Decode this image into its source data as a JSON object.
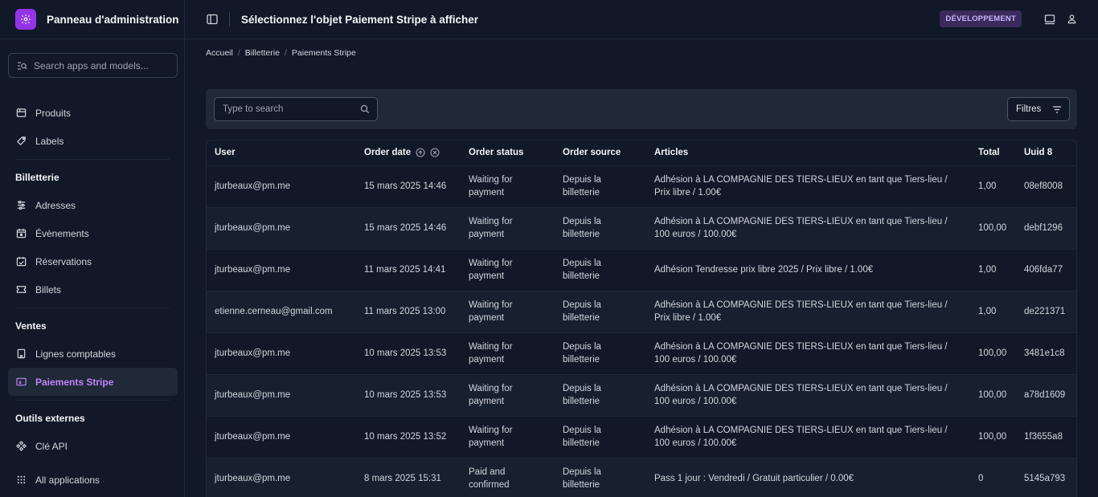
{
  "brand": {
    "title": "Panneau d'administration"
  },
  "sidebar": {
    "search_placeholder": "Search apps and models...",
    "items_top": [
      {
        "label": "Produits",
        "icon": "box-icon"
      },
      {
        "label": "Labels",
        "icon": "tag-icon"
      }
    ],
    "sections": [
      {
        "title": "Billetterie",
        "items": [
          {
            "label": "Adresses",
            "icon": "sliders-icon"
          },
          {
            "label": "Évènements",
            "icon": "calendar-icon"
          },
          {
            "label": "Réservations",
            "icon": "reservation-icon"
          },
          {
            "label": "Billets",
            "icon": "ticket-icon"
          }
        ]
      },
      {
        "title": "Ventes",
        "items": [
          {
            "label": "Lignes comptables",
            "icon": "document-icon"
          },
          {
            "label": "Paiements Stripe",
            "icon": "payment-icon",
            "active": true
          }
        ]
      },
      {
        "title": "Outils externes",
        "items": [
          {
            "label": "Clé API",
            "icon": "api-icon"
          }
        ]
      }
    ],
    "all_apps": "All applications"
  },
  "header": {
    "title": "Sélectionnez l'objet Paiement Stripe à afficher",
    "env_badge": "DÉVELOPPEMENT"
  },
  "breadcrumb": [
    "Accueil",
    "Billetterie",
    "Paiements Stripe"
  ],
  "toolbar": {
    "search_placeholder": "Type to search",
    "filters_label": "Filtres"
  },
  "table": {
    "columns": [
      "User",
      "Order date",
      "Order status",
      "Order source",
      "Articles",
      "Total",
      "Uuid 8"
    ],
    "rows": [
      {
        "user": "jturbeaux@pm.me",
        "date": "15 mars 2025 14:46",
        "status_1": "Waiting for",
        "status_2": "payment",
        "source_1": "Depuis la",
        "source_2": "billetterie",
        "art_1": "Adhésion à LA COMPAGNIE DES TIERS-LIEUX en tant que Tiers-lieu /",
        "art_2": "Prix libre / 1.00€",
        "total": "1,00",
        "uuid": "08ef8008"
      },
      {
        "user": "jturbeaux@pm.me",
        "date": "15 mars 2025 14:46",
        "status_1": "Waiting for",
        "status_2": "payment",
        "source_1": "Depuis la",
        "source_2": "billetterie",
        "art_1": "Adhésion à LA COMPAGNIE DES TIERS-LIEUX en tant que Tiers-lieu /",
        "art_2": "100 euros / 100.00€",
        "total": "100,00",
        "uuid": "debf1296"
      },
      {
        "user": "jturbeaux@pm.me",
        "date": "11 mars 2025 14:41",
        "status_1": "Waiting for",
        "status_2": "payment",
        "source_1": "Depuis la",
        "source_2": "billetterie",
        "art_1": "Adhésion Tendresse prix libre 2025 / Prix libre / 1.00€",
        "art_2": "",
        "total": "1,00",
        "uuid": "406fda77"
      },
      {
        "user": "etienne.cerneau@gmail.com",
        "date": "11 mars 2025 13:00",
        "status_1": "Waiting for",
        "status_2": "payment",
        "source_1": "Depuis la",
        "source_2": "billetterie",
        "art_1": "Adhésion à LA COMPAGNIE DES TIERS-LIEUX en tant que Tiers-lieu /",
        "art_2": "Prix libre / 1.00€",
        "total": "1,00",
        "uuid": "de221371"
      },
      {
        "user": "jturbeaux@pm.me",
        "date": "10 mars 2025 13:53",
        "status_1": "Waiting for",
        "status_2": "payment",
        "source_1": "Depuis la",
        "source_2": "billetterie",
        "art_1": "Adhésion à LA COMPAGNIE DES TIERS-LIEUX en tant que Tiers-lieu /",
        "art_2": "100 euros / 100.00€",
        "total": "100,00",
        "uuid": "3481e1c8"
      },
      {
        "user": "jturbeaux@pm.me",
        "date": "10 mars 2025 13:53",
        "status_1": "Waiting for",
        "status_2": "payment",
        "source_1": "Depuis la",
        "source_2": "billetterie",
        "art_1": "Adhésion à LA COMPAGNIE DES TIERS-LIEUX en tant que Tiers-lieu /",
        "art_2": "100 euros / 100.00€",
        "total": "100,00",
        "uuid": "a78d1609"
      },
      {
        "user": "jturbeaux@pm.me",
        "date": "10 mars 2025 13:52",
        "status_1": "Waiting for",
        "status_2": "payment",
        "source_1": "Depuis la",
        "source_2": "billetterie",
        "art_1": "Adhésion à LA COMPAGNIE DES TIERS-LIEUX en tant que Tiers-lieu /",
        "art_2": "100 euros / 100.00€",
        "total": "100,00",
        "uuid": "1f3655a8"
      },
      {
        "user": "jturbeaux@pm.me",
        "date": "8 mars 2025 15:31",
        "status_1": "Paid and",
        "status_2": "confirmed",
        "source_1": "Depuis la",
        "source_2": "billetterie",
        "art_1": "Pass 1 jour : Vendredi / Gratuit particulier / 0.00€",
        "art_2": "",
        "total": "0",
        "uuid": "5145a793"
      }
    ]
  },
  "colors": {
    "accent": "#9333ea",
    "active_text": "#c084fc",
    "background": "#111827"
  }
}
